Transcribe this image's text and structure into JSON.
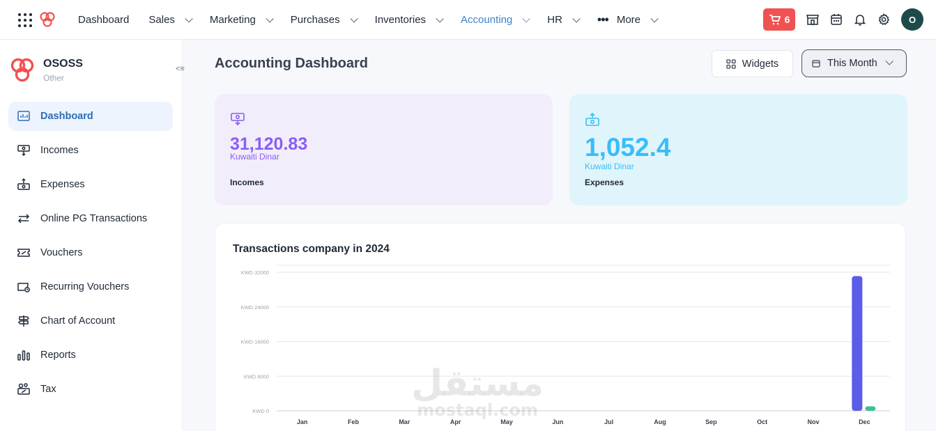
{
  "nav": {
    "items": [
      {
        "label": "Dashboard",
        "dropdown": false,
        "active": false
      },
      {
        "label": "Sales",
        "dropdown": true,
        "active": false
      },
      {
        "label": "Marketing",
        "dropdown": true,
        "active": false
      },
      {
        "label": "Purchases",
        "dropdown": true,
        "active": false
      },
      {
        "label": "Inventories",
        "dropdown": true,
        "active": false
      },
      {
        "label": "Accounting",
        "dropdown": true,
        "active": true
      },
      {
        "label": "HR",
        "dropdown": true,
        "active": false
      },
      {
        "label": "More",
        "dropdown": true,
        "active": false
      }
    ],
    "cart_count": "6",
    "avatar_initial": "O",
    "accent_color": "#3b82c8",
    "cart_color": "#f05252"
  },
  "sidebar": {
    "org_name": "OSOSS",
    "org_type": "Other",
    "items": [
      {
        "label": "Dashboard",
        "icon": "dashboard-icon",
        "active": true
      },
      {
        "label": "Incomes",
        "icon": "income-icon",
        "active": false
      },
      {
        "label": "Expenses",
        "icon": "expense-icon",
        "active": false
      },
      {
        "label": "Online PG Transactions",
        "icon": "transfer-icon",
        "active": false
      },
      {
        "label": "Vouchers",
        "icon": "voucher-icon",
        "active": false
      },
      {
        "label": "Recurring Vouchers",
        "icon": "recurring-voucher-icon",
        "active": false
      },
      {
        "label": "Chart of Account",
        "icon": "signpost-icon",
        "active": false
      },
      {
        "label": "Reports",
        "icon": "reports-icon",
        "active": false
      },
      {
        "label": "Tax",
        "icon": "tax-icon",
        "active": false
      }
    ]
  },
  "main": {
    "title": "Accounting Dashboard",
    "widgets_label": "Widgets",
    "period_label": "This Month",
    "cards": {
      "income": {
        "amount": "31,120.83",
        "currency": "Kuwaiti Dinar",
        "label": "Incomes",
        "color": "#8b5cf6"
      },
      "expense": {
        "amount": "1,052.4",
        "currency": "Kuwaiti Dinar",
        "label": "Expenses",
        "color": "#38bdf8"
      }
    },
    "chart_title": "Transactions company in 2024"
  },
  "chart_data": {
    "type": "bar",
    "title": "Transactions company in 2024",
    "categories": [
      "Jan",
      "Feb",
      "Mar",
      "Apr",
      "May",
      "Jun",
      "Jul",
      "Aug",
      "Sep",
      "Oct",
      "Nov",
      "Dec"
    ],
    "series": [
      {
        "values": [
          0,
          0,
          0,
          0,
          0,
          0,
          0,
          0,
          0,
          0,
          0,
          31120.83
        ],
        "color": "#5b5ce8"
      },
      {
        "values": [
          0,
          0,
          0,
          0,
          0,
          0,
          0,
          0,
          0,
          0,
          0,
          1052.4
        ],
        "color": "#3fbf8f"
      }
    ],
    "yticks": [
      "KWD 0",
      "KWD 8000",
      "KWD 16000",
      "KWD 24000",
      "KWD 32000"
    ],
    "ylim": [
      0,
      32000
    ],
    "grid": true
  },
  "watermark": {
    "ar": "مستقل",
    "en": "mostaql.com"
  }
}
